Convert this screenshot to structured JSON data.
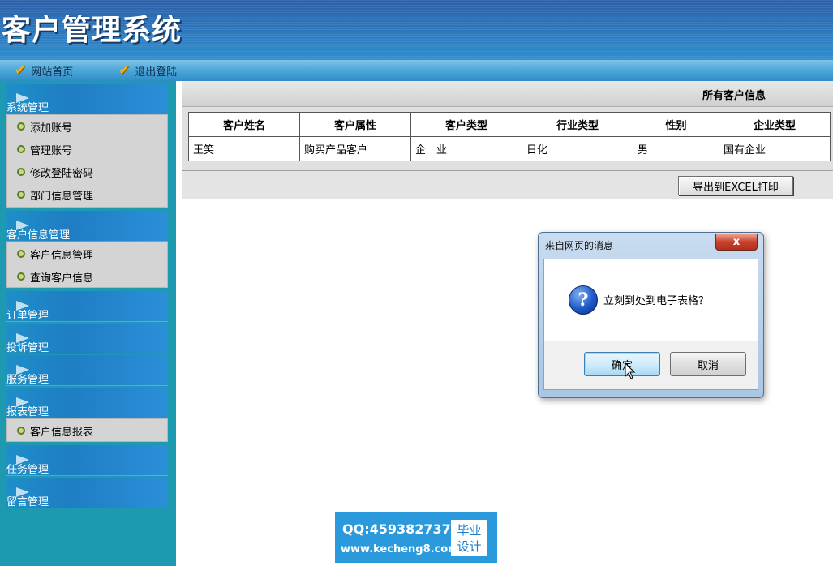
{
  "app": {
    "title": "客户管理系统"
  },
  "nav": {
    "items": [
      {
        "label": "网站首页",
        "icon": "checkmark-icon"
      },
      {
        "label": "退出登陆",
        "icon": "checkmark-icon"
      }
    ]
  },
  "sidebar": {
    "groups": [
      {
        "label": "系统管理",
        "items": [
          "添加账号",
          "管理账号",
          "修改登陆密码",
          "部门信息管理"
        ]
      },
      {
        "label": "客户信息管理",
        "items": [
          "客户信息管理",
          "查询客户信息"
        ]
      },
      {
        "label": "订单管理",
        "items": []
      },
      {
        "label": "投诉管理",
        "items": []
      },
      {
        "label": "服务管理",
        "items": []
      },
      {
        "label": "报表管理",
        "items": [
          "客户信息报表"
        ]
      },
      {
        "label": "任务管理",
        "items": []
      },
      {
        "label": "留言管理",
        "items": []
      }
    ]
  },
  "main": {
    "panel_title": "所有客户信息",
    "table": {
      "headers": [
        "客户姓名",
        "客户属性",
        "客户类型",
        "行业类型",
        "性别",
        "企业类型"
      ],
      "rows": [
        [
          "王笑",
          "购买产品客户",
          "企　业",
          "日化",
          "男",
          "国有企业"
        ]
      ]
    },
    "export_button": "导出到EXCEL打印"
  },
  "dialog": {
    "title": "来自网页的消息",
    "close": "x",
    "icon": "question-icon",
    "message": "立刻到处到电子表格？",
    "ok": "确定",
    "cancel": "取消"
  },
  "watermark": {
    "qq": "QQ:459382737",
    "url": "www.kecheng8.com",
    "badge_line1": "毕业",
    "badge_line2": "设计"
  },
  "colors": {
    "header": "#2d7cc0",
    "sidebar": "#1d9ab0",
    "group_head": "#1f7dc4",
    "dialog_border": "#51708f",
    "watermark": "#2a9adc"
  }
}
